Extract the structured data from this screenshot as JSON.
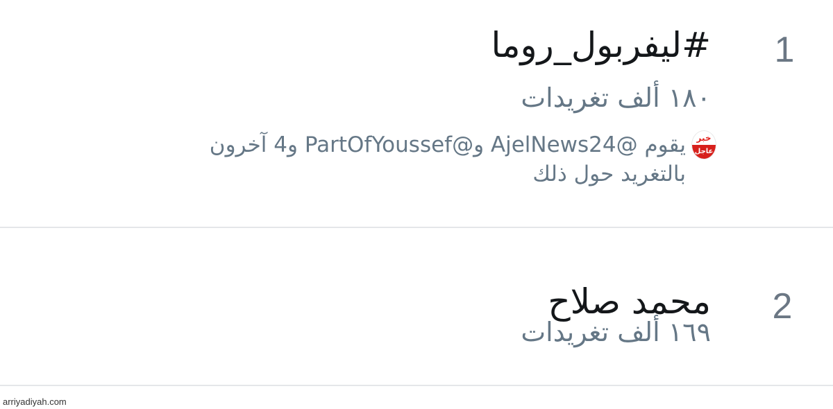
{
  "trends": [
    {
      "rank": "1",
      "topic": "#ليفربول_روما",
      "tweet_count": "١٨٠ ألف تغريدات",
      "context": {
        "avatar_top": "خبر",
        "avatar_bottom": "عاجل",
        "line1": "يقوم @AjelNews24 و@PartOfYoussef و4 آخرون",
        "line2": "بالتغريد حول ذلك"
      }
    },
    {
      "rank": "2",
      "topic": "محمد صلاح",
      "tweet_count": "١٦٩ ألف تغريدات"
    }
  ],
  "watermark": "arriyadiyah.com"
}
